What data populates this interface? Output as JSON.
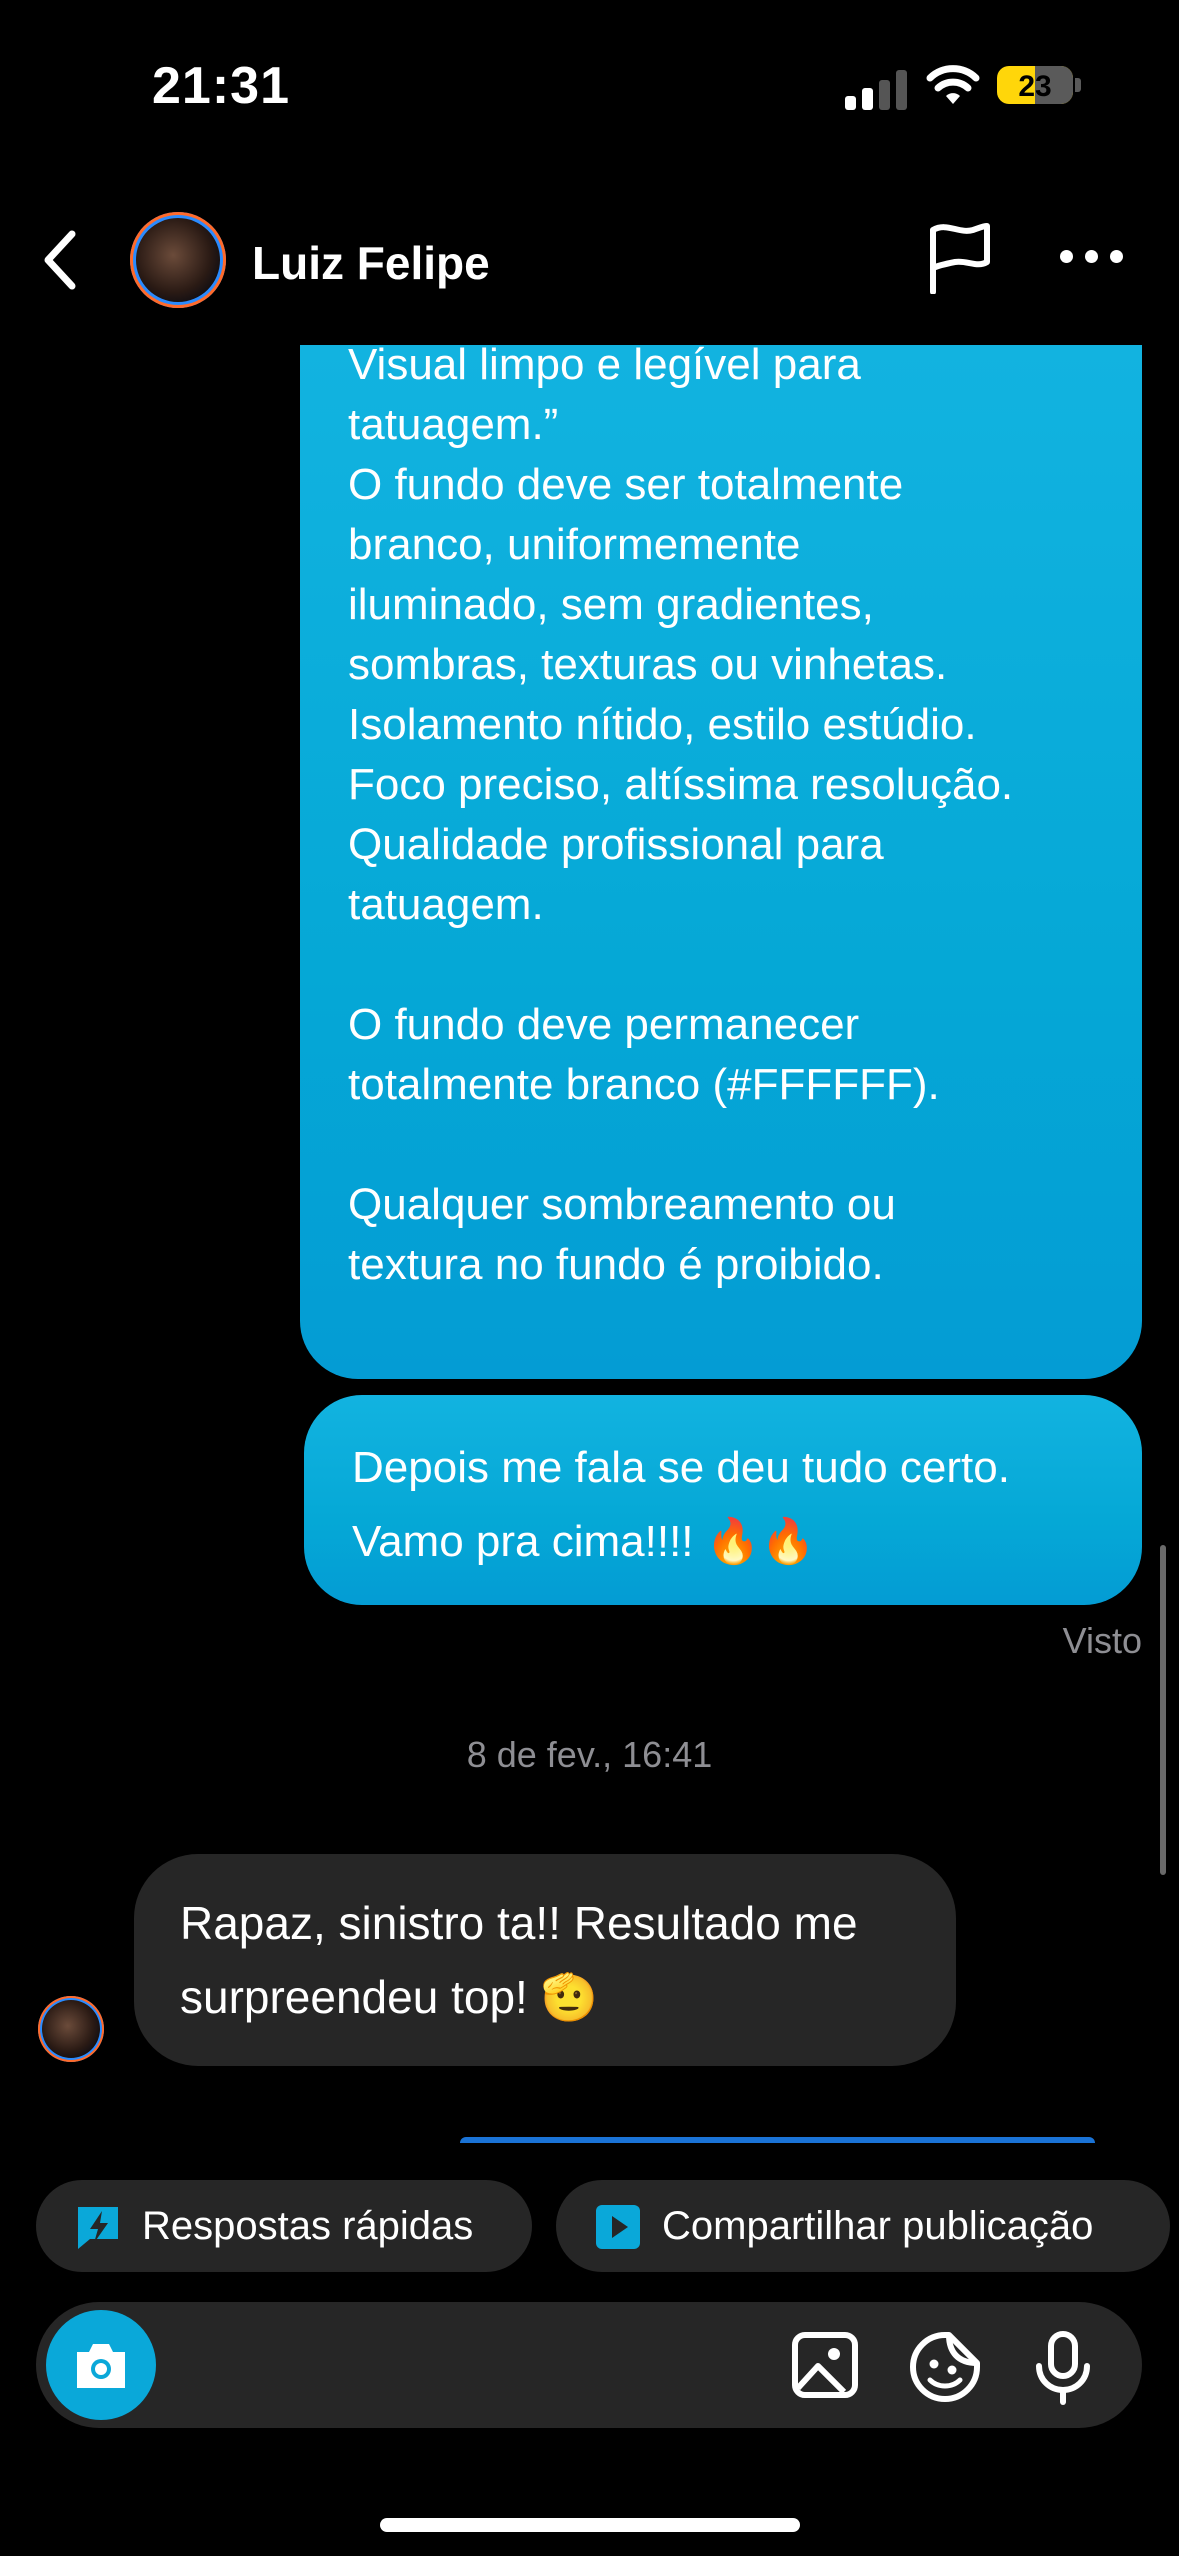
{
  "status_bar": {
    "time": "21:31",
    "battery": "23"
  },
  "header": {
    "contact_name": "Luiz Felipe"
  },
  "messages": {
    "outgoing_long": "Visual limpo e legível para\ntatuagem.”\nO fundo deve ser totalmente\nbranco, uniformemente\niluminado, sem gradientes,\nsombras, texturas ou vinhetas.\nIsolamento nítido, estilo estúdio.\nFoco preciso, altíssima resolução.\nQualidade profissional para\ntatuagem.\n\nO fundo deve permanecer\ntotalmente branco (#FFFFFF).\n\nQualquer sombreamento ou\ntextura no fundo é proibido.",
    "outgoing_short": "Depois me fala se deu tudo certo.\nVamo pra cima!!!! 🔥🔥",
    "seen_label": "Visto",
    "timestamp": "8 de fev., 16:41",
    "incoming": "Rapaz, sinistro ta!! Resultado me\nsurpreendeu top! 🫡"
  },
  "quick_actions": {
    "quick_replies": "Respostas rápidas",
    "share_post": "Compartilhar publicação"
  },
  "colors": {
    "bubble_out": "#05a8d6",
    "bubble_in": "#262626",
    "accent": "#0aa8d9"
  },
  "icons": [
    "chevron-left-icon",
    "flag-icon",
    "more-icon",
    "camera-icon",
    "gallery-icon",
    "sticker-icon",
    "microphone-icon",
    "quick-reply-icon",
    "share-post-icon"
  ]
}
